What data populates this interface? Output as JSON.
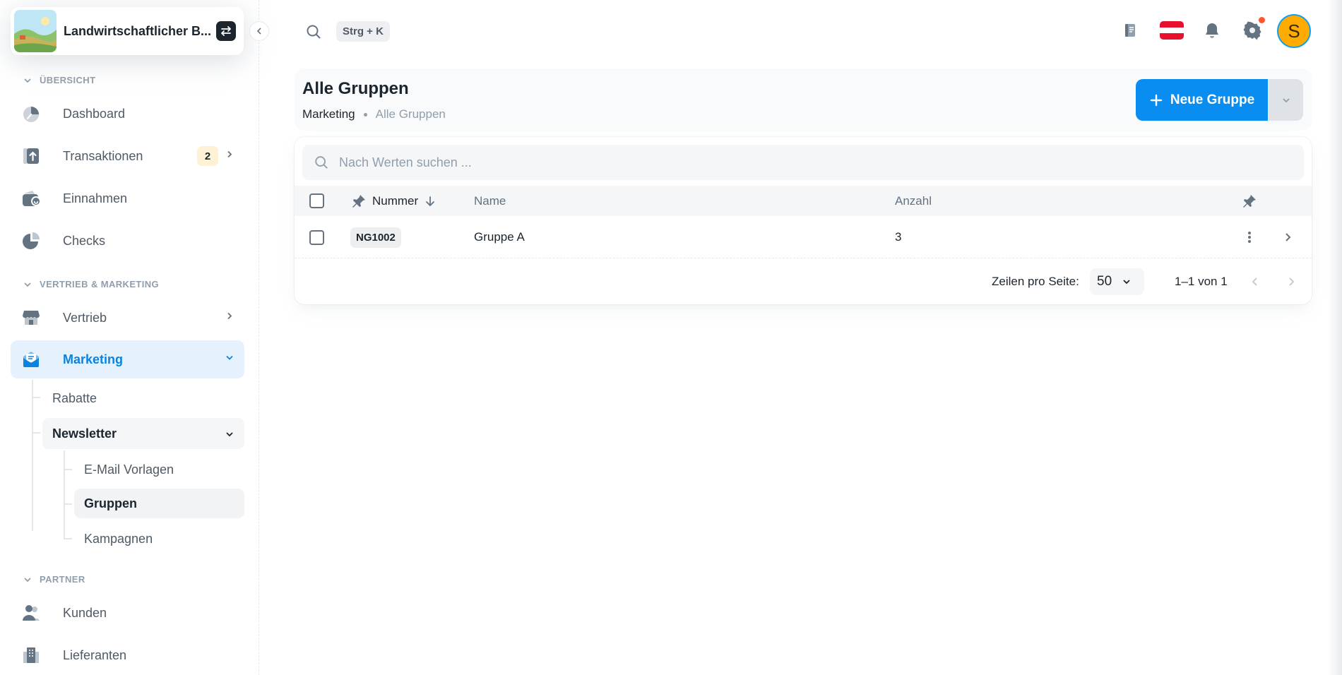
{
  "workspace": {
    "name": "Landwirtschaftlicher B..."
  },
  "topbar": {
    "search_shortcut": "Strg + K",
    "avatar_initial": "S"
  },
  "sidebar": {
    "sections": [
      {
        "title": "ÜBERSICHT"
      },
      {
        "title": "VERTRIEB & MARKETING"
      },
      {
        "title": "PARTNER"
      }
    ],
    "items": [
      {
        "label": "Dashboard"
      },
      {
        "label": "Transaktionen",
        "badge": "2"
      },
      {
        "label": "Einnahmen"
      },
      {
        "label": "Checks"
      },
      {
        "label": "Vertrieb"
      },
      {
        "label": "Marketing"
      },
      {
        "label": "Kunden"
      },
      {
        "label": "Lieferanten"
      }
    ],
    "marketing_children": [
      {
        "label": "Rabatte"
      },
      {
        "label": "Newsletter"
      }
    ],
    "newsletter_children": [
      {
        "label": "E-Mail Vorlagen"
      },
      {
        "label": "Gruppen"
      },
      {
        "label": "Kampagnen"
      }
    ]
  },
  "header": {
    "title": "Alle Gruppen",
    "breadcrumb": [
      "Marketing",
      "Alle Gruppen"
    ],
    "new_button": "Neue Gruppe"
  },
  "table": {
    "search_placeholder": "Nach Werten suchen ...",
    "columns": [
      "Nummer",
      "Name",
      "Anzahl"
    ],
    "rows": [
      {
        "nummer": "NG1002",
        "name": "Gruppe A",
        "anzahl": "3"
      }
    ],
    "footer": {
      "rows_per_page_label": "Zeilen pro Seite:",
      "rows_per_page": "50",
      "range": "1–1 von 1"
    }
  },
  "colors": {
    "accent": "#0a8df0",
    "active_bg": "#e5f2fd",
    "avatar": "#ffab00"
  }
}
